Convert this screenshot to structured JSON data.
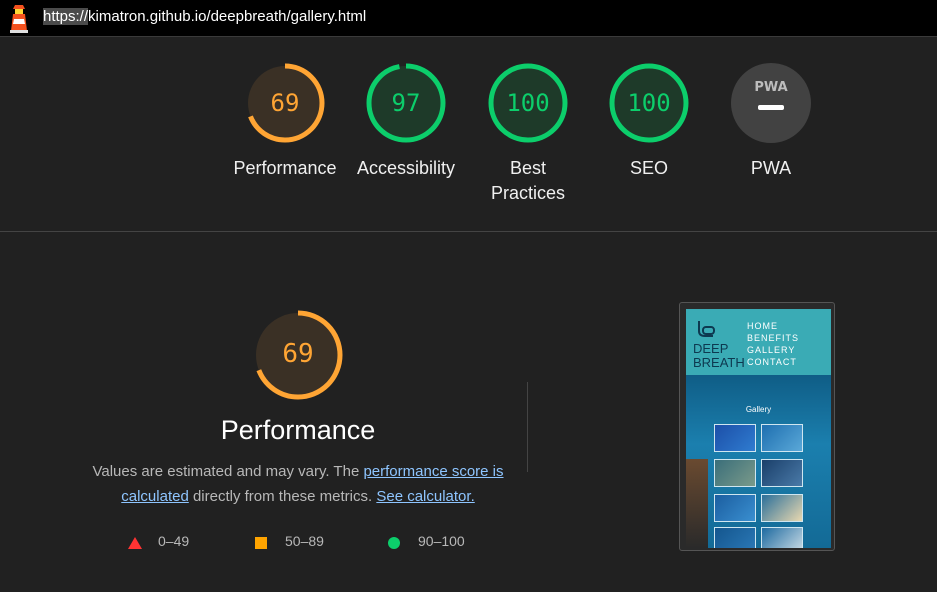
{
  "browser": {
    "url_highlight": "https://",
    "url_rest": "kimatron.github.io/deepbreath/gallery.html"
  },
  "gauges": [
    {
      "score": "69",
      "label": "Performance",
      "value": 69,
      "color": "#ffa534",
      "bg": "#3a3025"
    },
    {
      "score": "97",
      "label": "Accessibility",
      "value": 97,
      "color": "#0cce6b",
      "bg": "#1e3a29"
    },
    {
      "score": "100",
      "label": "Best Practices",
      "value": 100,
      "color": "#0cce6b",
      "bg": "#1e3a29"
    },
    {
      "score": "100",
      "label": "SEO",
      "value": 100,
      "color": "#0cce6b",
      "bg": "#1e3a29"
    },
    {
      "score": "",
      "label": "PWA",
      "badge": "PWA",
      "color": "#bdbdbd",
      "bg": "#424242"
    }
  ],
  "performance": {
    "score": "69",
    "value": 69,
    "title": "Performance",
    "desc_before": "Values are estimated and may vary. The ",
    "link1": "performance score is calculated",
    "desc_middle": " directly from these metrics. ",
    "link2": "See calculator."
  },
  "legend": [
    {
      "range": "0–49",
      "shape": "triangle",
      "color": "#ff3333"
    },
    {
      "range": "50–89",
      "shape": "square",
      "color": "#ffa400"
    },
    {
      "range": "90–100",
      "shape": "circle",
      "color": "#0cce6b"
    }
  ],
  "thumbnail": {
    "brand_line1": "DEEP",
    "brand_line2": "BREATH",
    "menu": [
      "HOME",
      "BENEFITS",
      "GALLERY",
      "CONTACT"
    ],
    "gallery_title": "Gallery",
    "header_color": "#3aabb5"
  }
}
